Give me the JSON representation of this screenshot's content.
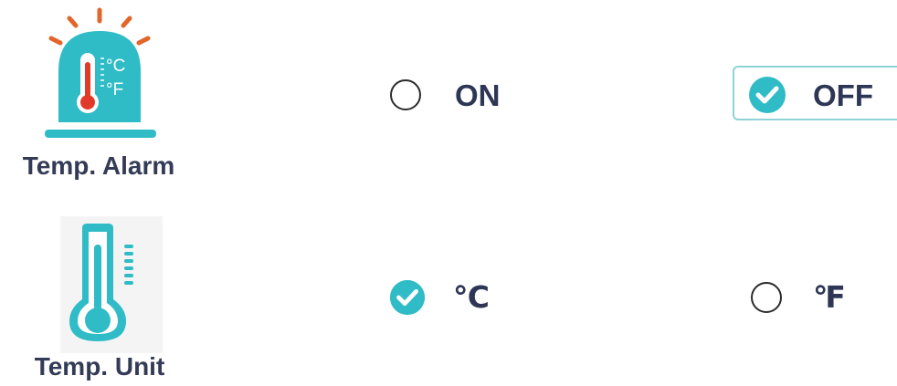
{
  "alarm": {
    "label": "Temp. Alarm",
    "icon_celsius": "°C",
    "icon_fahrenheit": "°F",
    "options": [
      {
        "label": "ON",
        "selected": false
      },
      {
        "label": "OFF",
        "selected": true
      }
    ]
  },
  "unit": {
    "label": "Temp. Unit",
    "options": [
      {
        "label": "℃",
        "selected": true
      },
      {
        "label": "℉",
        "selected": false
      }
    ]
  },
  "colors": {
    "accent": "#2fbcc6",
    "alarm_rays": "#e2652b",
    "mercury": "#e23a2a",
    "text": "#2e3656"
  },
  "icons": {
    "alarm": "thermometer-alarm-icon",
    "unit": "thermometer-icon",
    "checked": "check-circle-icon",
    "unchecked": "radio-empty-icon"
  }
}
